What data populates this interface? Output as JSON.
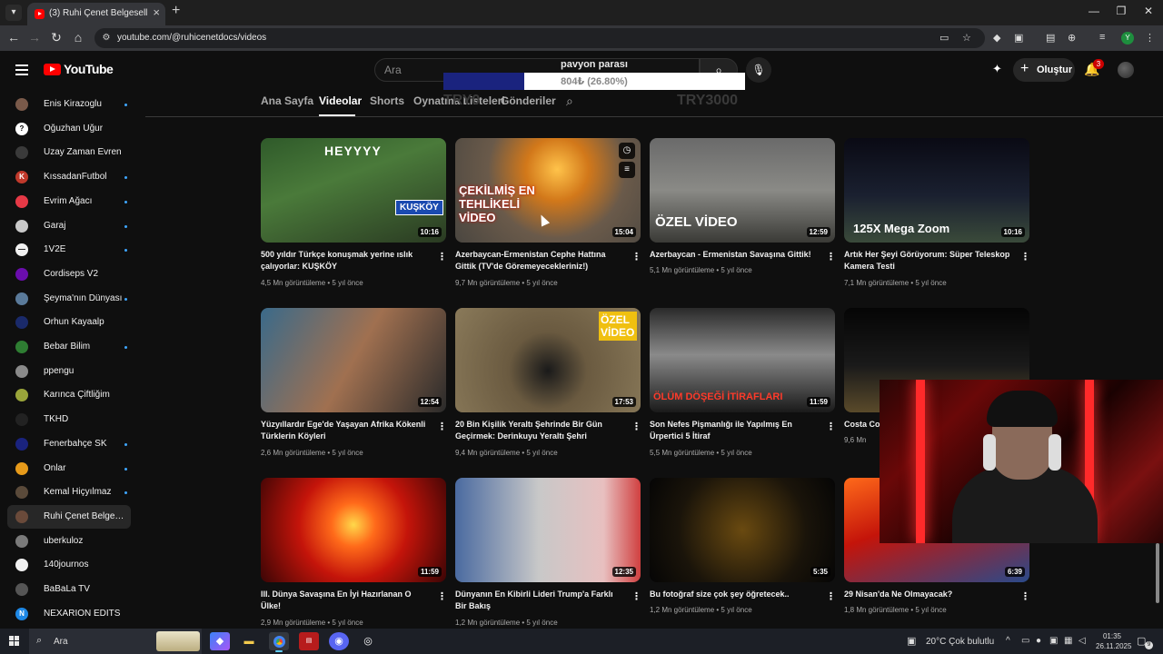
{
  "browser": {
    "tab_title": "(3) Ruhi Çenet Belgeselleri - Yo",
    "url": "youtube.com/@ruhicenetdocs/videos",
    "profile_initial": "Y"
  },
  "header": {
    "logo_text": "YouTube",
    "search_placeholder": "Ara",
    "create_label": "Oluştur",
    "notification_count": "3"
  },
  "overlay": {
    "title": "pavyon parası",
    "amount_text": "804₺ (26.80%)",
    "progress": 0.268,
    "min_label": "TRY0",
    "max_label": "TRY3000"
  },
  "channel_tabs": [
    "Ana Sayfa",
    "Videolar",
    "Shorts",
    "Oynatma Listeleri",
    "Gönderiler"
  ],
  "sidebar": [
    {
      "label": "Enis Kirazoglu",
      "dot": true,
      "color": "#7a5a4a",
      "initial": ""
    },
    {
      "label": "Oğuzhan Uğur",
      "dot": false,
      "color": "#ffffff",
      "initial": "?"
    },
    {
      "label": "Uzay Zaman Evren",
      "dot": false,
      "color": "#3a3a3a",
      "initial": ""
    },
    {
      "label": "KıssadanFutbol",
      "dot": true,
      "color": "#c0392b",
      "initial": "K"
    },
    {
      "label": "Evrim Ağacı",
      "dot": true,
      "color": "#e63946",
      "initial": ""
    },
    {
      "label": "Garaj",
      "dot": true,
      "color": "#c9c9c9",
      "initial": ""
    },
    {
      "label": "1V2E",
      "dot": true,
      "color": "#f1f1f1",
      "initial": "—"
    },
    {
      "label": "Cordiseps V2",
      "dot": false,
      "color": "#6a0dad",
      "initial": ""
    },
    {
      "label": "Şeyma'nın Dünyası",
      "dot": true,
      "color": "#5a7a9a",
      "initial": ""
    },
    {
      "label": "Orhun Kayaalp",
      "dot": false,
      "color": "#1a2a6a",
      "initial": ""
    },
    {
      "label": "Bebar Bilim",
      "dot": true,
      "color": "#2e7d32",
      "initial": ""
    },
    {
      "label": "ppengu",
      "dot": false,
      "color": "#8a8a8a",
      "initial": ""
    },
    {
      "label": "Karınca Çiftliğim",
      "dot": false,
      "color": "#9aa53a",
      "initial": ""
    },
    {
      "label": "TKHD",
      "dot": false,
      "color": "#222222",
      "initial": ""
    },
    {
      "label": "Fenerbahçe SK",
      "dot": true,
      "color": "#1a237e",
      "initial": ""
    },
    {
      "label": "Onlar",
      "dot": true,
      "color": "#e69a1a",
      "initial": ""
    },
    {
      "label": "Kemal Hiçyılmaz",
      "dot": true,
      "color": "#5a4a3a",
      "initial": ""
    },
    {
      "label": "Ruhi Çenet Belgese...",
      "dot": false,
      "color": "#6a4a3a",
      "initial": "",
      "active": true
    },
    {
      "label": "uberkuloz",
      "dot": false,
      "color": "#7a7a7a",
      "initial": ""
    },
    {
      "label": "140journos",
      "dot": false,
      "color": "#f1f1f1",
      "initial": ""
    },
    {
      "label": "BaBaLa TV",
      "dot": false,
      "color": "#555555",
      "initial": ""
    },
    {
      "label": "NEXARİON EDİTS",
      "dot": false,
      "color": "#1e88e5",
      "initial": "N"
    }
  ],
  "videos": [
    {
      "title": "500 yıldır Türkçe konuşmak yerine ıslık çalıyorlar: KUŞKÖY",
      "views": "4,5 Mn görüntüleme",
      "age": "5 yıl önce",
      "duration": "10:16",
      "thumb_text": "HEYYYY",
      "thumb_text2": "KUŞKÖY"
    },
    {
      "title": "Azerbaycan-Ermenistan Cephe Hattına Gittik (TV'de Göremeyecekleriniz!)",
      "views": "9,7 Mn görüntüleme",
      "age": "5 yıl önce",
      "duration": "15:04",
      "thumb_text": "ÇEKİLMİŞ EN TEHLİKELİ VİDEO",
      "thumb_text2": ""
    },
    {
      "title": "Azerbaycan - Ermenistan Savaşına Gittik!",
      "views": "5,1 Mn görüntüleme",
      "age": "5 yıl önce",
      "duration": "12:59",
      "thumb_text": "ÖZEL VİDEO",
      "thumb_text2": ""
    },
    {
      "title": "Artık Her Şeyi Görüyorum: Süper Teleskop Kamera Testi",
      "views": "7,1 Mn görüntüleme",
      "age": "5 yıl önce",
      "duration": "10:16",
      "thumb_text": "125X Mega Zoom",
      "thumb_text2": ""
    },
    {
      "title": "Yüzyıllardır Ege'de Yaşayan Afrika Kökenli Türklerin Köyleri",
      "views": "2,6 Mn görüntüleme",
      "age": "5 yıl önce",
      "duration": "12:54",
      "thumb_text": "",
      "thumb_text2": ""
    },
    {
      "title": "20 Bin Kişilik Yeraltı Şehrinde Bir Gün Geçirmek: Derinkuyu Yeraltı Şehri",
      "views": "9,4 Mn görüntüleme",
      "age": "5 yıl önce",
      "duration": "17:53",
      "thumb_text": "ÖZEL VİDEO",
      "thumb_text2": ""
    },
    {
      "title": "Son Nefes Pişmanlığı ile Yapılmış En Ürpertici 5 İtiraf",
      "views": "5,5 Mn görüntüleme",
      "age": "5 yıl önce",
      "duration": "11:59",
      "thumb_text": "ÖLÜM DÖŞEĞİ İTİRAFLARI",
      "thumb_text2": ""
    },
    {
      "title": "Costa Co",
      "views": "9,6 Mn",
      "age": "",
      "duration": "",
      "thumb_text": "",
      "thumb_text2": ""
    },
    {
      "title": "III. Dünya Savaşına En İyi Hazırlanan O Ülke!",
      "views": "2,9 Mn görüntüleme",
      "age": "5 yıl önce",
      "duration": "11:59",
      "thumb_text": "",
      "thumb_text2": ""
    },
    {
      "title": "Dünyanın En Kibirli Lideri Trump'a Farklı Bir Bakış",
      "views": "1,2 Mn görüntüleme",
      "age": "5 yıl önce",
      "duration": "12:35",
      "thumb_text": "",
      "thumb_text2": ""
    },
    {
      "title": "Bu fotoğraf size çok şey öğretecek..",
      "views": "1,2 Mn görüntüleme",
      "age": "5 yıl önce",
      "duration": "5:35",
      "thumb_text": "",
      "thumb_text2": ""
    },
    {
      "title": "29 Nisan'da Ne Olmayacak?",
      "views": "1,8 Mn görüntüleme",
      "age": "5 yıl önce",
      "duration": "6:39",
      "thumb_text": "",
      "thumb_text2": ""
    }
  ],
  "taskbar": {
    "search_text": "Ara",
    "weather": "20°C  Çok bulutlu",
    "time": "01:35",
    "date": "26.11.2025",
    "notif_count": "9"
  }
}
